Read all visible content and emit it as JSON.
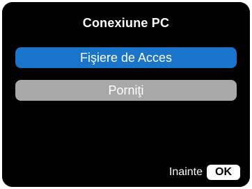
{
  "screen": {
    "title": "Conexiune PC"
  },
  "menu": {
    "items": [
      {
        "label": "Fişiere de Acces",
        "selected": true
      },
      {
        "label": "Porniţi",
        "selected": false
      }
    ]
  },
  "footer": {
    "hint_label": "Inainte",
    "ok_label": "OK"
  },
  "colors": {
    "background": "#000000",
    "selected_item": "#1a74c9",
    "unselected_item": "#a8a8a8",
    "text": "#ffffff"
  }
}
